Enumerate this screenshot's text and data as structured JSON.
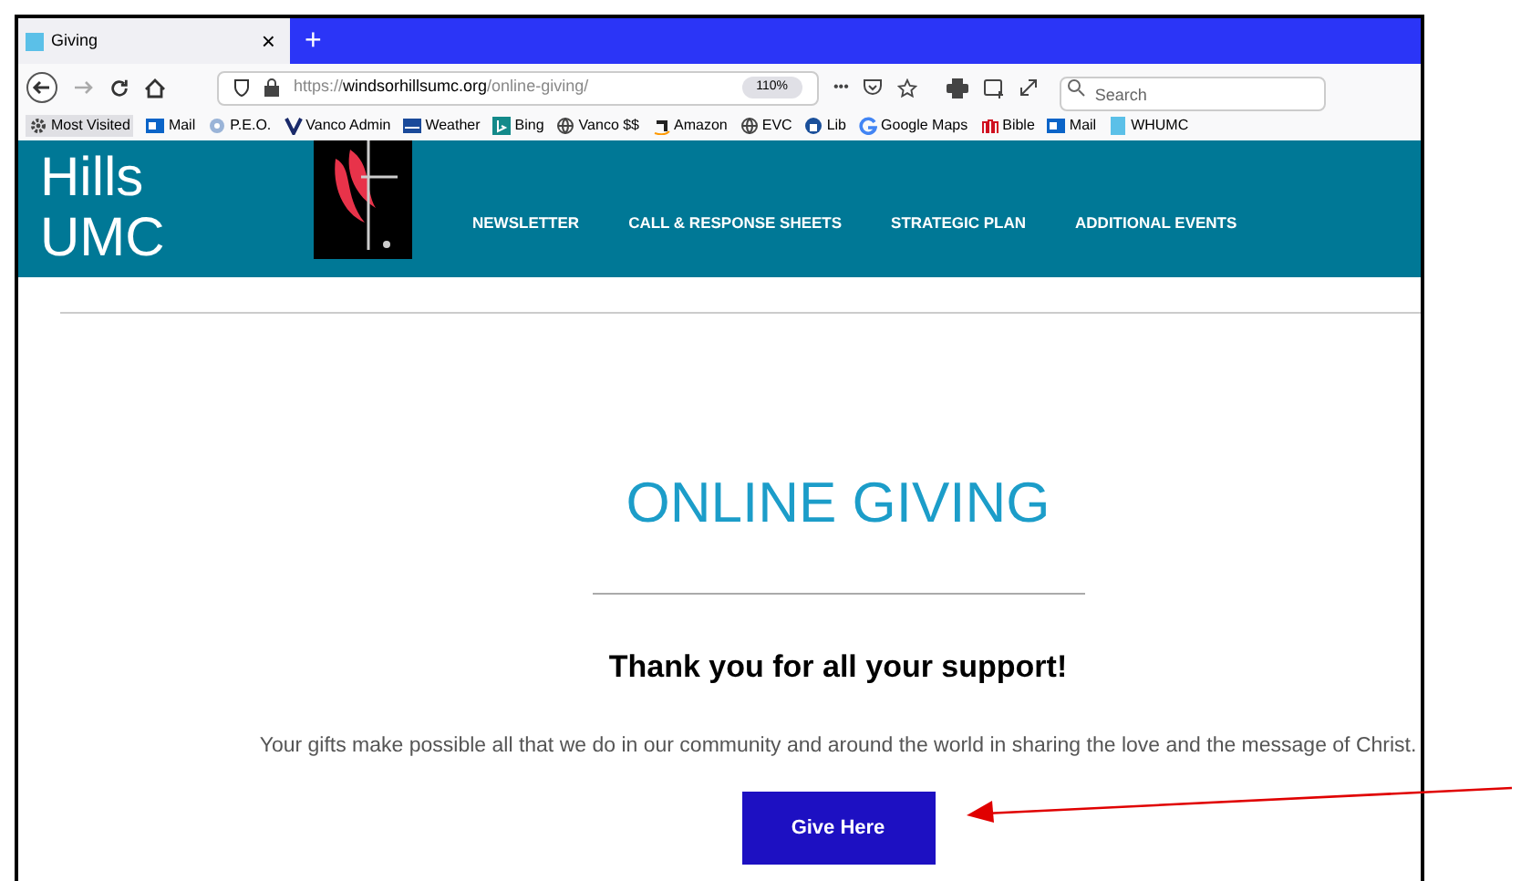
{
  "tab": {
    "title": "Giving",
    "close": "×",
    "new_tab": "+"
  },
  "toolbar": {
    "url_prefix": "https://",
    "url_domain": "windsorhillsumc.org",
    "url_path": "/online-giving/",
    "zoom": "110%",
    "more": "•••",
    "search_placeholder": "Search"
  },
  "bookmarks": [
    {
      "label": "Most Visited"
    },
    {
      "label": "Mail"
    },
    {
      "label": "P.E.O."
    },
    {
      "label": "Vanco Admin"
    },
    {
      "label": "Weather"
    },
    {
      "label": "Bing"
    },
    {
      "label": "Vanco $$"
    },
    {
      "label": "Amazon"
    },
    {
      "label": "EVC"
    },
    {
      "label": "Lib"
    },
    {
      "label": "Google Maps"
    },
    {
      "label": "Bible"
    },
    {
      "label": "Mail"
    },
    {
      "label": "WHUMC"
    }
  ],
  "site": {
    "name_lines": [
      "Hills",
      "UMC"
    ],
    "nav": [
      "NEWSLETTER",
      "CALL & RESPONSE SHEETS",
      "STRATEGIC PLAN",
      "ADDITIONAL EVENTS"
    ]
  },
  "content": {
    "heading": "ONLINE GIVING",
    "subheading": "Thank you for all your support!",
    "paragraph": "Your gifts make possible all that we do in our community and around the world in sharing the love and the message of Christ.",
    "button": "Give Here"
  }
}
